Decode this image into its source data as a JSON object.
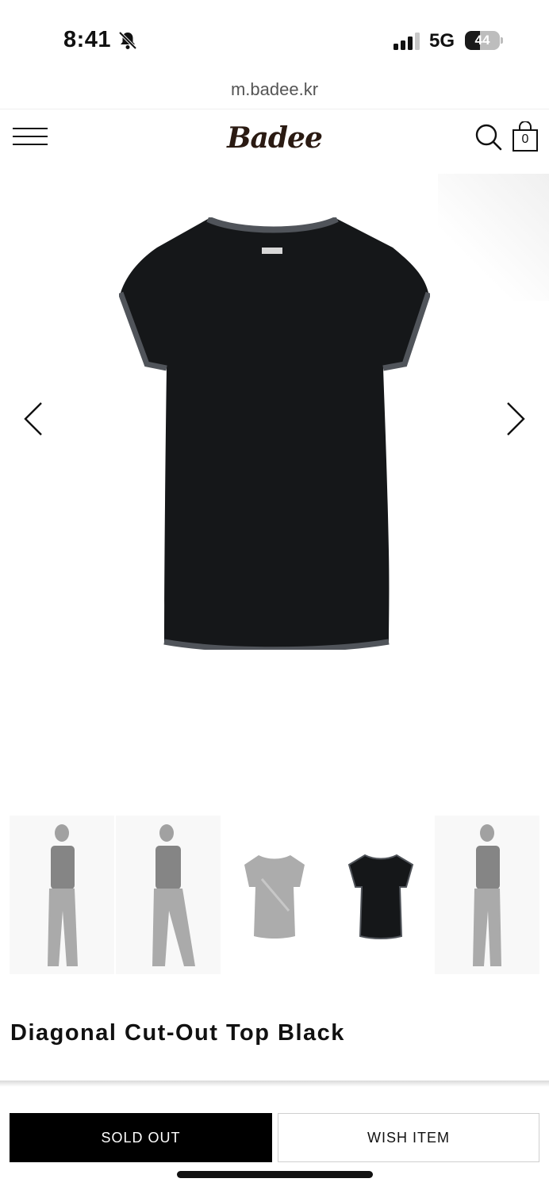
{
  "status_bar": {
    "time": "8:41",
    "network": "5G",
    "battery_level": "44",
    "icons": [
      "bell-slash-icon",
      "signal-icon",
      "battery-icon"
    ]
  },
  "browser": {
    "url": "m.badee.kr"
  },
  "header": {
    "logo_text": "Badee",
    "cart_count": "0",
    "icons": [
      "hamburger-menu-icon",
      "search-icon",
      "cart-icon"
    ]
  },
  "gallery": {
    "arrows": [
      "chevron-left-icon",
      "chevron-right-icon"
    ],
    "thumbnail_count": 5,
    "active_thumbnail_index": 3
  },
  "product": {
    "title": "Diagonal Cut-Out Top Black"
  },
  "actions": {
    "sold_out_label": "SOLD OUT",
    "wish_label": "WISH ITEM"
  },
  "colors": {
    "primary_button_bg": "#000000",
    "primary_button_text": "#ffffff",
    "logo": "#2a1a12"
  }
}
